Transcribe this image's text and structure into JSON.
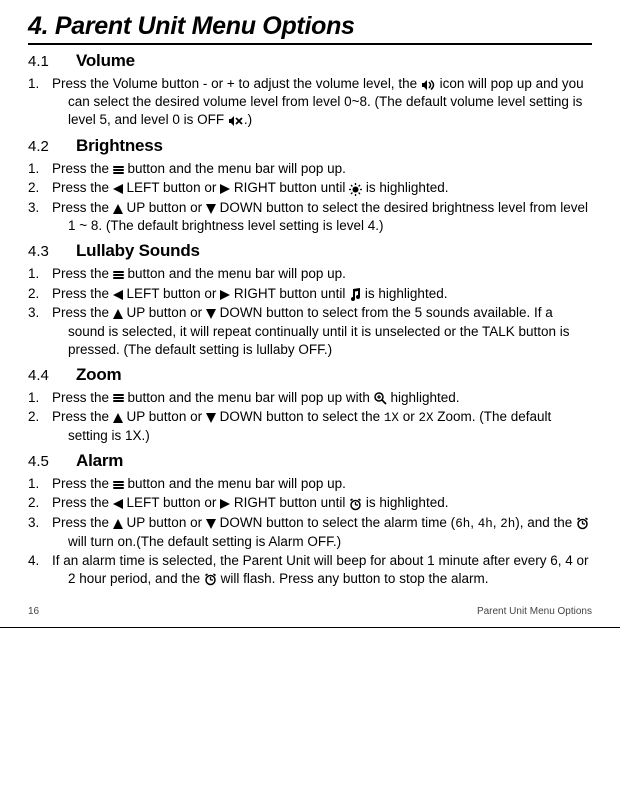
{
  "pageTitle": "4. Parent Unit Menu Options",
  "sections": [
    {
      "num": "4.1",
      "title": "Volume",
      "steps": [
        "Press the Volume button - or + to adjust the volume level, the {volume-icon} icon will pop up and you can select the desired volume level from level 0~8. (The default volume level setting is level 5, and level 0 is OFF {volume-mute-icon}.)"
      ]
    },
    {
      "num": "4.2",
      "title": "Brightness",
      "steps": [
        "Press the {menu-icon} button and the menu bar will pop up.",
        "Press the {left} LEFT button or {right} RIGHT button until {brightness-icon} is highlighted.",
        "Press the {up} UP button or {down} DOWN button to select the desired brightness level from level 1 ~ 8. (The default brightness level setting is level 4.)"
      ]
    },
    {
      "num": "4.3",
      "title": "Lullaby Sounds",
      "steps": [
        "Press the {menu-icon} button and the menu bar will pop up.",
        "Press the {left} LEFT button or {right} RIGHT button until {music-icon} is highlighted.",
        "Press the {up} UP button or {down} DOWN button to select from the 5 sounds available. If a sound is selected, it will repeat continually until it is unselected or the TALK button is pressed. (The default setting is lullaby OFF.)"
      ]
    },
    {
      "num": "4.4",
      "title": "Zoom",
      "steps": [
        "Press the {menu-icon} button and the menu bar will pop up with {zoom-icon} highlighted.",
        "Press the {up} UP button or {down} DOWN button to select the {code:1X} or {code:2X} Zoom. (The default setting is 1X.)"
      ]
    },
    {
      "num": "4.5",
      "title": "Alarm",
      "steps": [
        "Press the {menu-icon} button and the menu bar will pop up.",
        "Press the {left} LEFT button or {right} RIGHT button until {alarm-icon} is highlighted.",
        "Press the {up} UP button or {down} DOWN button to select the alarm time ({code:6h}, {code:4h}, {code:2h}), and the {alarm-icon} will turn on.(The default setting is Alarm OFF.)",
        "If an alarm time is selected, the Parent Unit will beep for about 1 minute after every 6, 4 or 2 hour period, and the {alarm-icon} will flash. Press any button to stop the alarm."
      ]
    }
  ],
  "footer": {
    "pageNum": "16",
    "section": "Parent Unit Menu Options"
  }
}
